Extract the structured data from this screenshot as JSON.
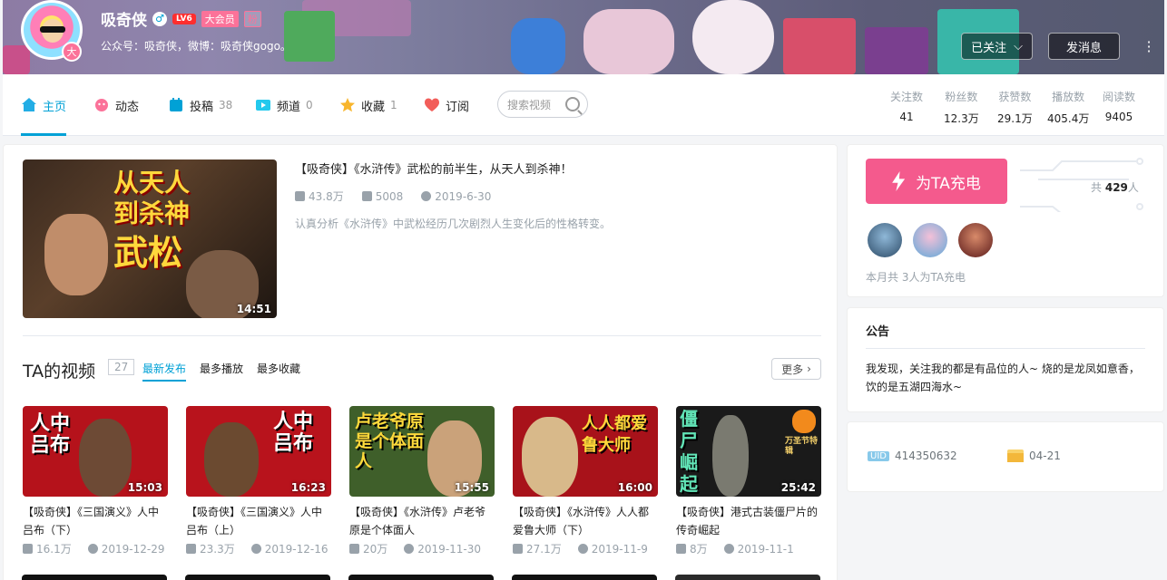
{
  "header": {
    "username": "吸奇侠",
    "gender_icon": "male-icon",
    "level": "LV6",
    "vip_label": "大会员",
    "fan_label": "粉",
    "avatar_badge": "大",
    "signature": "公众号：吸奇侠，微博：吸奇侠gogo。",
    "follow_label": "已关注",
    "message_label": "发消息"
  },
  "nav": {
    "tabs": [
      {
        "label": "主页",
        "count": "",
        "icon": "home-icon",
        "color": "#23ade5"
      },
      {
        "label": "动态",
        "count": "",
        "icon": "dynamic-icon",
        "color": "#fb7299"
      },
      {
        "label": "投稿",
        "count": "38",
        "icon": "upload-icon",
        "color": "#00a1d6"
      },
      {
        "label": "频道",
        "count": "0",
        "icon": "channel-icon",
        "color": "#23c9ed"
      },
      {
        "label": "收藏",
        "count": "1",
        "icon": "star-icon",
        "color": "#f8b52c"
      },
      {
        "label": "订阅",
        "count": "",
        "icon": "heart-icon",
        "color": "#f25d59"
      }
    ],
    "search_placeholder": "搜索视频"
  },
  "stats": [
    {
      "label": "关注数",
      "value": "41"
    },
    {
      "label": "粉丝数",
      "value": "12.3万"
    },
    {
      "label": "获赞数",
      "value": "29.1万"
    },
    {
      "label": "播放数",
      "value": "405.4万"
    },
    {
      "label": "阅读数",
      "value": "9405"
    }
  ],
  "featured": {
    "cover_text": [
      "从天人",
      "到杀神",
      "武松"
    ],
    "duration": "14:51",
    "title": "【吸奇侠】《水浒传》武松的前半生，从天人到杀神！",
    "plays": "43.8万",
    "danmaku": "5008",
    "date": "2019-6-30",
    "desc": "认真分析《水浒传》中武松经历几次剧烈人生变化后的性格转变。"
  },
  "videos_section": {
    "title": "TA的视频",
    "count": "27",
    "sorts": [
      "最新发布",
      "最多播放",
      "最多收藏"
    ],
    "more": "更多"
  },
  "videos": [
    {
      "cover_text": "人中吕布",
      "tag": "下",
      "duration": "15:03",
      "title": "【吸奇侠】《三国演义》人中吕布（下）",
      "plays": "16.1万",
      "date": "2019-12-29",
      "bg": "#b5121b"
    },
    {
      "cover_text": "人中吕布",
      "tag": "上",
      "duration": "16:23",
      "title": "【吸奇侠】《三国演义》人中吕布（上）",
      "plays": "23.3万",
      "date": "2019-12-16",
      "bg": "#b8131c"
    },
    {
      "cover_text": "卢老爷原是个体面人",
      "tag": "",
      "duration": "15:55",
      "title": "【吸奇侠】《水浒传》卢老爷原是个体面人",
      "plays": "20万",
      "date": "2019-11-30",
      "bg": "#3f5f2a"
    },
    {
      "cover_text": "人人都爱鲁大师",
      "tag": "下",
      "duration": "16:00",
      "title": "【吸奇侠】《水浒传》人人都爱鲁大师（下）",
      "plays": "27.1万",
      "date": "2019-11-9",
      "bg": "#a8121a"
    },
    {
      "cover_text": "僵尸崛起",
      "tag": "万圣节特辑",
      "duration": "25:42",
      "title": "【吸奇侠】港式古装僵尸片的传奇崛起",
      "plays": "8万",
      "date": "2019-11-1",
      "bg": "#1a1a1a"
    }
  ],
  "charge": {
    "button": "为TA充电",
    "total_prefix": "共",
    "total": "429",
    "total_suffix": "人",
    "note": "本月共 3人为TA充电"
  },
  "notice": {
    "title": "公告",
    "text": "我发现，关注我的都是有品位的人~ 烧的是龙凤如意香，饮的是五湖四海水~"
  },
  "info": {
    "uid_label": "UID",
    "uid": "414350632",
    "birthday": "04-21"
  }
}
